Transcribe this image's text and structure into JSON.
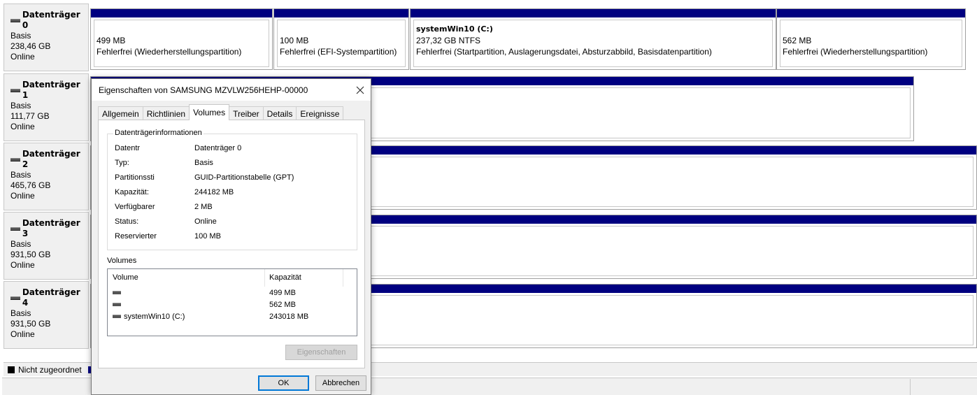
{
  "disks": [
    {
      "title": "Datenträger 0",
      "type": "Basis",
      "size": "238,46 GB",
      "status": "Online"
    },
    {
      "title": "Datenträger 1",
      "type": "Basis",
      "size": "111,77 GB",
      "status": "Online"
    },
    {
      "title": "Datenträger 2",
      "type": "Basis",
      "size": "465,76 GB",
      "status": "Online"
    },
    {
      "title": "Datenträger 3",
      "type": "Basis",
      "size": "931,50 GB",
      "status": "Online"
    },
    {
      "title": "Datenträger 4",
      "type": "Basis",
      "size": "931,50 GB",
      "status": "Online"
    }
  ],
  "disk0_partitions": [
    {
      "name": "",
      "size": "499 MB",
      "status": "Fehlerfrei (Wiederherstellungspartition)"
    },
    {
      "name": "",
      "size": "100 MB",
      "status": "Fehlerfrei (EFI-Systempartition)"
    },
    {
      "name": "systemWin10  (C:)",
      "size": "237,32 GB NTFS",
      "status": "Fehlerfrei (Startpartition, Auslagerungsdatei, Absturzabbild, Basisdatenpartition)"
    },
    {
      "name": "",
      "size": "562 MB",
      "status": "Fehlerfrei (Wiederherstellungspartition)"
    }
  ],
  "legend": {
    "unallocated": "Nicht zugeordnet"
  },
  "colors": {
    "partition_bar": "#000080",
    "dialog_bg": "#f0f0f0"
  },
  "dialog": {
    "title": "Eigenschaften von SAMSUNG MZVLW256HEHP-00000",
    "close_icon": "close-icon",
    "tabs": [
      "Allgemein",
      "Richtlinien",
      "Volumes",
      "Treiber",
      "Details",
      "Ereignisse"
    ],
    "active_tab": "Volumes",
    "info_group_caption": "Datenträgerinformationen",
    "info": [
      {
        "key": "Datentr",
        "value": "Datenträger 0"
      },
      {
        "key": "Typ:",
        "value": "Basis"
      },
      {
        "key": "Partitionssti",
        "value": "GUID-Partitionstabelle (GPT)"
      },
      {
        "key": "Kapazität:",
        "value": "244182 MB"
      },
      {
        "key": "Verfügbarer",
        "value": "2 MB"
      },
      {
        "key": "Status:",
        "value": "Online"
      },
      {
        "key": "Reservierter",
        "value": "100 MB"
      }
    ],
    "volumes_caption": "Volumes",
    "volumes_header": {
      "volume": "Volume",
      "capacity": "Kapazität"
    },
    "volumes": [
      {
        "name": "",
        "capacity": "499 MB"
      },
      {
        "name": "",
        "capacity": "562 MB"
      },
      {
        "name": "systemWin10 (C:)",
        "capacity": "243018 MB"
      }
    ],
    "properties_button": "Eigenschaften",
    "ok_button": "OK",
    "cancel_button": "Abbrechen"
  }
}
